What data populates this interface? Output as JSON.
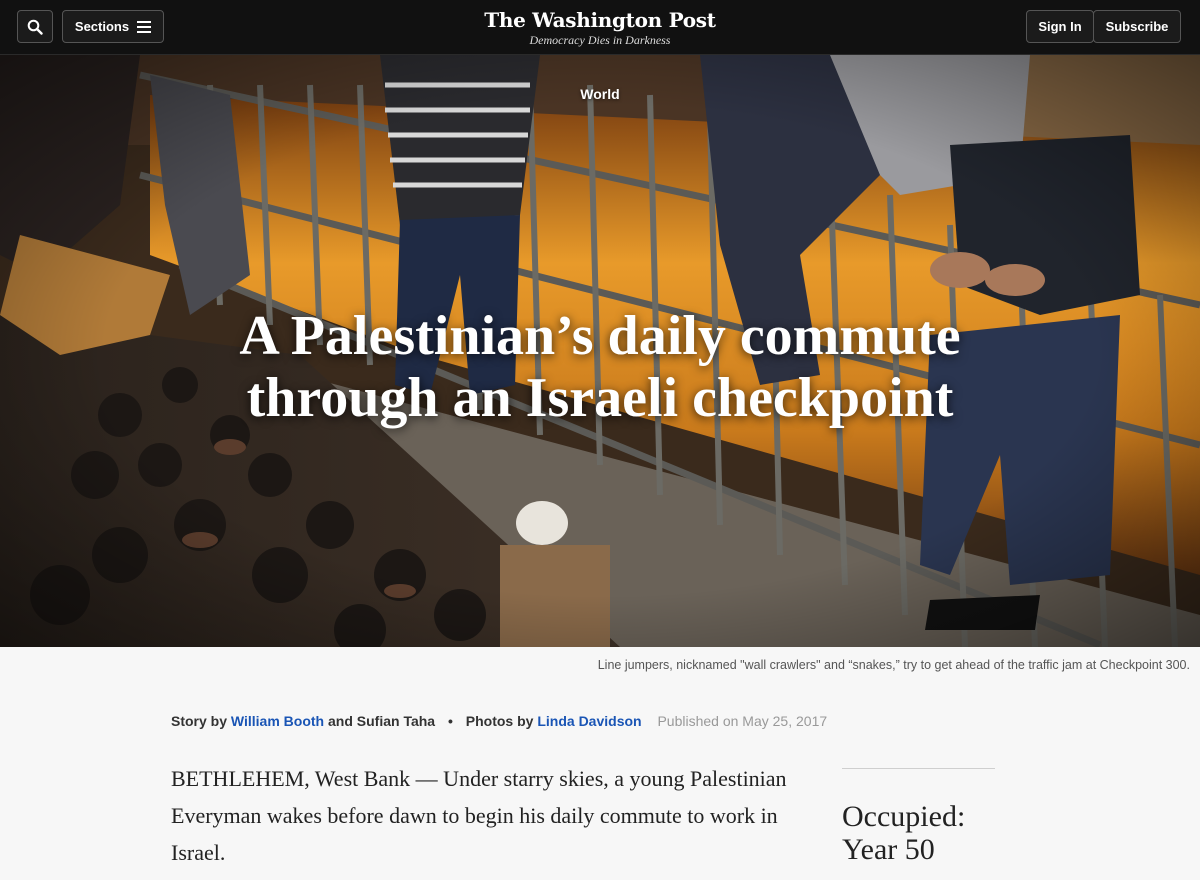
{
  "header": {
    "sections_label": "Sections",
    "logo_text": "The Washington Post",
    "tagline": "Democracy Dies in Darkness",
    "sign_in_label": "Sign In",
    "subscribe_label": "Subscribe",
    "search_icon": "search-icon",
    "menu_icon": "hamburger-icon"
  },
  "hero": {
    "kicker": "World",
    "headline": "A Palestinian’s daily commute through an Israeli checkpoint",
    "caption": "Line jumpers, nicknamed \"wall crawlers\" and “snakes,” try to get ahead of the traffic jam at Checkpoint 300."
  },
  "byline": {
    "story_prefix": "Story by",
    "author1": "William Booth",
    "and_label": "and",
    "author2": "Sufian Taha",
    "separator": "•",
    "photos_prefix": "Photos by",
    "photographer": "Linda Davidson",
    "published": "Published on May 25, 2017"
  },
  "article": {
    "lede": "BETHLEHEM, West Bank — Under starry skies, a young Palestinian Everyman wakes before dawn to begin his daily commute to work in Israel."
  },
  "sidebar": {
    "series_title_line1": "Occupied:",
    "series_title_line2": "Year 50"
  },
  "colors": {
    "topbar": "#111111",
    "link": "#1a55b5",
    "page_bg": "#f7f7f7"
  }
}
